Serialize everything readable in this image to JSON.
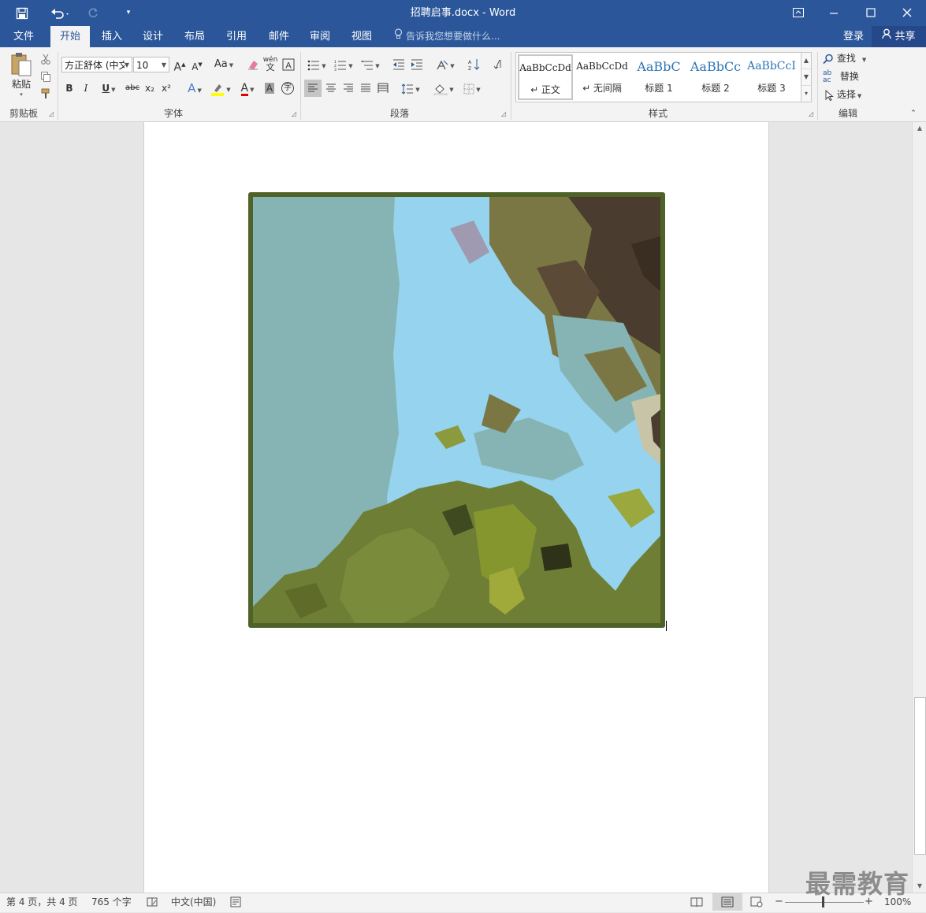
{
  "window": {
    "title": "招聘启事.docx - Word",
    "quick_access": [
      "save-icon",
      "undo-icon",
      "redo-icon",
      "customize-icon"
    ],
    "controls": [
      "ribbon-display-icon",
      "minimize-icon",
      "maximize-icon",
      "close-icon"
    ]
  },
  "tabs": [
    {
      "label": "文件",
      "active": false
    },
    {
      "label": "开始",
      "active": true
    },
    {
      "label": "插入",
      "active": false
    },
    {
      "label": "设计",
      "active": false
    },
    {
      "label": "布局",
      "active": false
    },
    {
      "label": "引用",
      "active": false
    },
    {
      "label": "邮件",
      "active": false
    },
    {
      "label": "审阅",
      "active": false
    },
    {
      "label": "视图",
      "active": false
    }
  ],
  "tell_me": {
    "placeholder": "告诉我您想要做什么..."
  },
  "account": {
    "login": "登录",
    "share": "共享"
  },
  "ribbon": {
    "clipboard": {
      "label": "剪贴板",
      "paste": "粘贴"
    },
    "font": {
      "label": "字体",
      "font_name": "方正舒体 (中⽂",
      "font_size": "10",
      "grow": "A",
      "shrink": "A",
      "change_case": "Aa",
      "phonetic": "wén",
      "bold": "B",
      "italic": "I",
      "underline": "U",
      "strike": "abc",
      "subscript": "x₂",
      "superscript": "x²",
      "text_effects": "A",
      "font_color": "A",
      "char_shading": "A",
      "enclose": "字"
    },
    "paragraph": {
      "label": "段落"
    },
    "styles": {
      "label": "样式",
      "items": [
        {
          "sample": "AaBbCcDd",
          "name": "↵ 正文",
          "selected": true
        },
        {
          "sample": "AaBbCcDd",
          "name": "↵ 无间隔",
          "selected": false
        },
        {
          "sample": "AaBbC",
          "name": "标题 1",
          "selected": false
        },
        {
          "sample": "AaBbCc",
          "name": "标题 2",
          "selected": false
        },
        {
          "sample": "AaBbCcI",
          "name": "标题 3",
          "selected": false
        }
      ]
    },
    "editing": {
      "label": "编辑",
      "find": "查找",
      "replace": "替换",
      "select": "选择"
    }
  },
  "status": {
    "page": "第 4 页，共 4 页",
    "words": "765 个字",
    "language": "中文(中国)",
    "zoom": "100%",
    "zoom_minus": "−",
    "zoom_plus": "+"
  },
  "watermark": "最需教育",
  "colors": {
    "brand": "#2b579a",
    "picture_border": "#4f6228"
  }
}
